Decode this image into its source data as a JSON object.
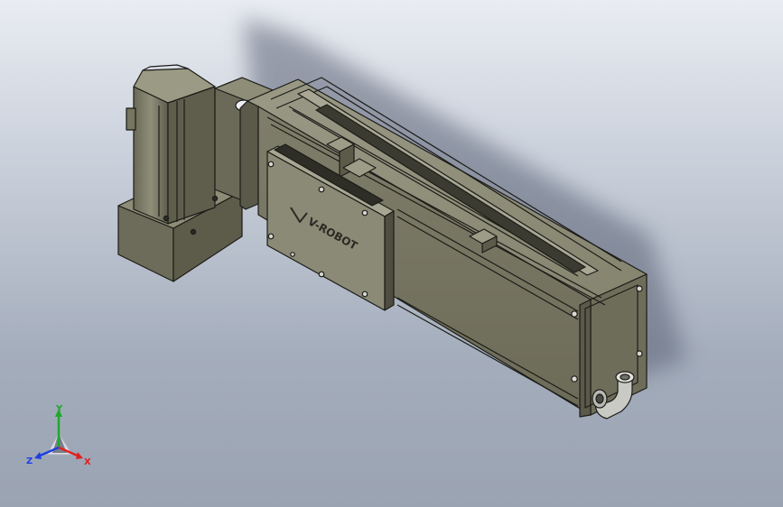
{
  "model": {
    "logo_text": "V-ROBOT"
  },
  "triad": {
    "x_label": "X",
    "y_label": "Y",
    "z_label": "Z",
    "x_color": "#e02020",
    "y_color": "#1fa82c",
    "z_color": "#1f3fe0"
  },
  "colors": {
    "background_top": "#e9ecf2",
    "background_bottom": "#9aa3b2",
    "body": "#7b7a68",
    "body_light": "#8e8d79",
    "body_dark": "#4c4b3f",
    "edge": "#1c1c18"
  }
}
